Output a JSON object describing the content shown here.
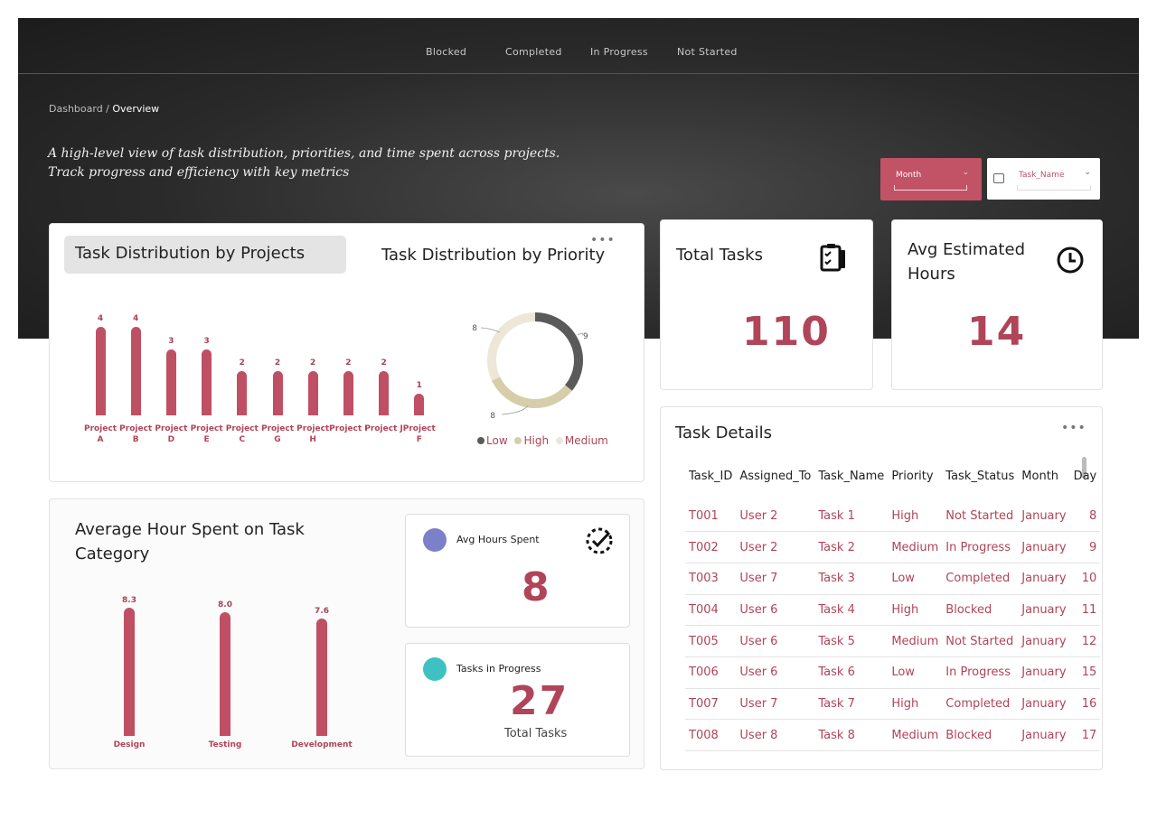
{
  "nav": [
    "Blocked",
    "Completed",
    "In Progress",
    "Not Started"
  ],
  "breadcrumb": {
    "parent": "Dashboard",
    "separator": " / ",
    "current": "Overview"
  },
  "tagline": [
    "A high-level view of task distribution, priorities, and time spent across projects.",
    "Track progress and efficiency with key metrics"
  ],
  "filters": {
    "month": "Month",
    "task_name": "Task_Name"
  },
  "colors": {
    "accent": "#bf5064",
    "low": "#5a5a5a",
    "high": "#d6ceaa",
    "medium": "#ece7d7",
    "avg_circle": "#7b80c9",
    "progress_circle": "#3fc1c4"
  },
  "projects_card": {
    "title": "Task Distribution by Projects",
    "menu_icon": "more-dots-icon"
  },
  "priority_card": {
    "title": "Task Distribution by Priority"
  },
  "total_tasks": {
    "title": "Total Tasks",
    "value": "110",
    "icon": "task-list-icon"
  },
  "avg_estimated": {
    "title_line1": "Avg Estimated",
    "title_line2": "Hours",
    "value": "14",
    "icon": "clock-icon"
  },
  "category_card": {
    "title_line1": "Average Hour Spent on Task",
    "title_line2": "Category"
  },
  "avg_hours": {
    "label": "Avg Hours Spent",
    "value": "8",
    "icon": "dashed-check-icon"
  },
  "in_progress": {
    "label": "Tasks in Progress",
    "value": "27",
    "sub": "Total Tasks"
  },
  "task_details": {
    "title": "Task Details",
    "columns": [
      "Task_ID",
      "Assigned_To",
      "Task_Name",
      "Priority",
      "Task_Status",
      "Month",
      "Day"
    ],
    "rows": [
      [
        "T001",
        "User 2",
        "Task 1",
        "High",
        "Not Started",
        "January",
        "8"
      ],
      [
        "T002",
        "User 2",
        "Task 2",
        "Medium",
        "In Progress",
        "January",
        "9"
      ],
      [
        "T003",
        "User 7",
        "Task 3",
        "Low",
        "Completed",
        "January",
        "10"
      ],
      [
        "T004",
        "User 6",
        "Task 4",
        "High",
        "Blocked",
        "January",
        "11"
      ],
      [
        "T005",
        "User 6",
        "Task 5",
        "Medium",
        "Not Started",
        "January",
        "12"
      ],
      [
        "T006",
        "User 6",
        "Task 6",
        "Low",
        "In Progress",
        "January",
        "15"
      ],
      [
        "T007",
        "User 7",
        "Task 7",
        "High",
        "Completed",
        "January",
        "16"
      ],
      [
        "T008",
        "User 8",
        "Task 8",
        "Medium",
        "Blocked",
        "January",
        "17"
      ]
    ]
  },
  "chart_data": [
    {
      "type": "bar",
      "categories": [
        "Project A",
        "Project B",
        "Project D",
        "Project E",
        "Project C",
        "Project G",
        "Project H",
        "Project I",
        "Project J",
        "Project F"
      ],
      "values": [
        4,
        4,
        3,
        3,
        2,
        2,
        2,
        2,
        2,
        1
      ],
      "title": "Task Distribution by Projects",
      "ylim": [
        0,
        4
      ]
    },
    {
      "type": "pie",
      "title": "Task Distribution by Priority",
      "categories": [
        "Low",
        "High",
        "Medium"
      ],
      "values": [
        9,
        8,
        8
      ],
      "donut": true,
      "legend": "bottom"
    },
    {
      "type": "bar",
      "categories": [
        "Design",
        "Testing",
        "Development"
      ],
      "values": [
        8.3,
        8.0,
        7.6
      ],
      "title": "Average Hour Spent on Task Category",
      "ylim": [
        0,
        8.3
      ]
    }
  ]
}
